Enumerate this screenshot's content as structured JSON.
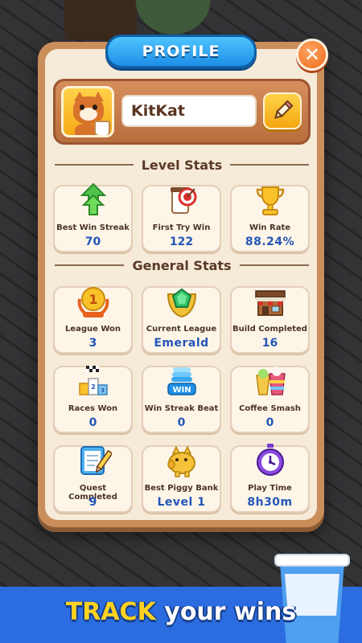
{
  "header": {
    "title": "PROFILE",
    "close_icon": "close-icon"
  },
  "profile": {
    "name": "KitKat",
    "avatar_icon": "cat-avatar-icon",
    "edit_icon": "pencil-icon"
  },
  "level_stats": {
    "title": "Level Stats",
    "cards": [
      {
        "label": "Best Win Streak",
        "value": "70",
        "icon": "green-arrows-icon"
      },
      {
        "label": "First Try Win",
        "value": "122",
        "icon": "target-cup-icon"
      },
      {
        "label": "Win Rate",
        "value": "88.24%",
        "icon": "trophy-icon"
      }
    ]
  },
  "general_stats": {
    "title": "General Stats",
    "cards": [
      {
        "label": "League Won",
        "value": "3",
        "icon": "medal-icon"
      },
      {
        "label": "Current League",
        "value": "Emerald",
        "icon": "emerald-badge-icon"
      },
      {
        "label": "Build Completed",
        "value": "16",
        "icon": "shop-building-icon"
      },
      {
        "label": "Races Won",
        "value": "0",
        "icon": "podium-flag-icon"
      },
      {
        "label": "Win Streak Beat",
        "value": "0",
        "icon": "win-stack-icon"
      },
      {
        "label": "Coffee Smash",
        "value": "0",
        "icon": "drinks-icon"
      },
      {
        "label": "Quest Completed",
        "value": "9",
        "icon": "clipboard-icon"
      },
      {
        "label": "Best Piggy Bank",
        "value": "Level 1",
        "icon": "piggy-bank-icon"
      },
      {
        "label": "Play Time",
        "value": "8h30m",
        "icon": "stopwatch-icon"
      }
    ]
  },
  "banner": {
    "highlight": "TRACK",
    "rest": " your wins"
  },
  "colors": {
    "panel_border": "#c98e5a",
    "panel_fill": "#f6ead8",
    "title_blue": "#1d8fe6",
    "value_blue": "#2356b8",
    "close_orange": "#f06a1c",
    "banner_blue": "#2b6de0",
    "highlight_yellow": "#ffd21f"
  }
}
